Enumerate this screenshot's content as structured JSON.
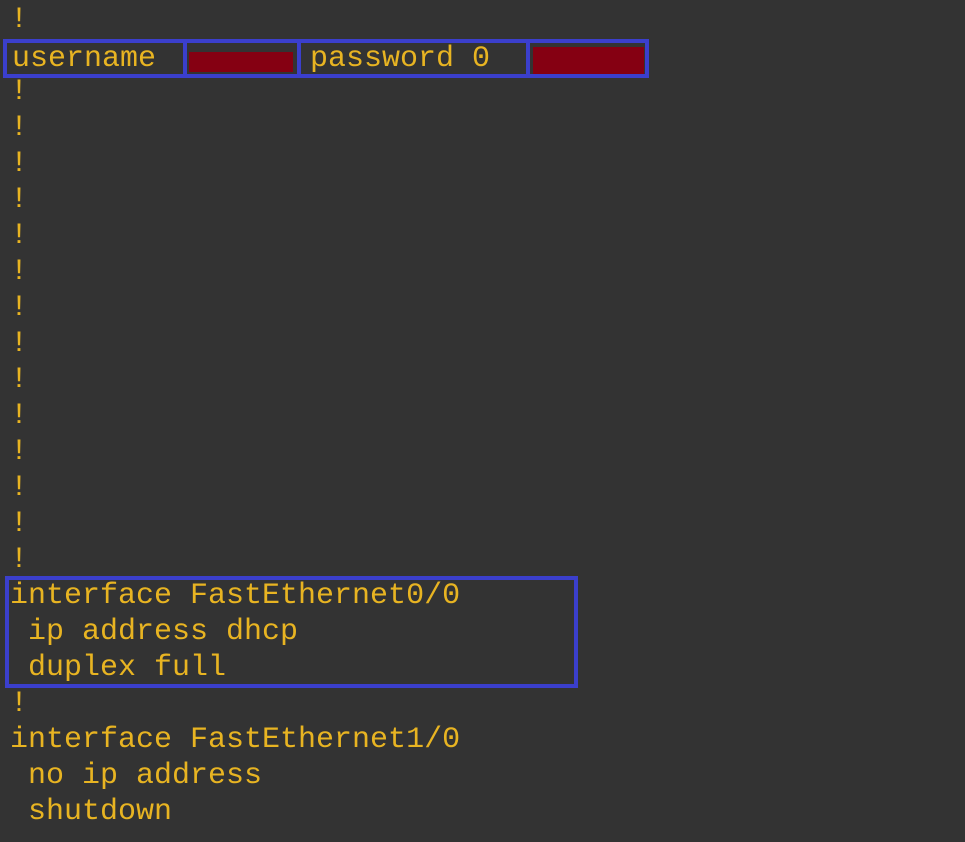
{
  "colors": {
    "background": "#333333",
    "text": "#e8b422",
    "highlight_border": "#3b3fcc",
    "redaction": "#850012"
  },
  "config": {
    "bang": "!",
    "username_line": {
      "keyword": "username",
      "password_keyword": "password 0",
      "username_value": "[redacted]",
      "password_value": "[redacted]"
    },
    "interface_fa00": {
      "line1": "interface FastEthernet0/0",
      "line2": " ip address dhcp",
      "line3": " duplex full"
    },
    "interface_fa10": {
      "line1": "interface FastEthernet1/0",
      "line2": " no ip address",
      "line3": " shutdown"
    }
  }
}
